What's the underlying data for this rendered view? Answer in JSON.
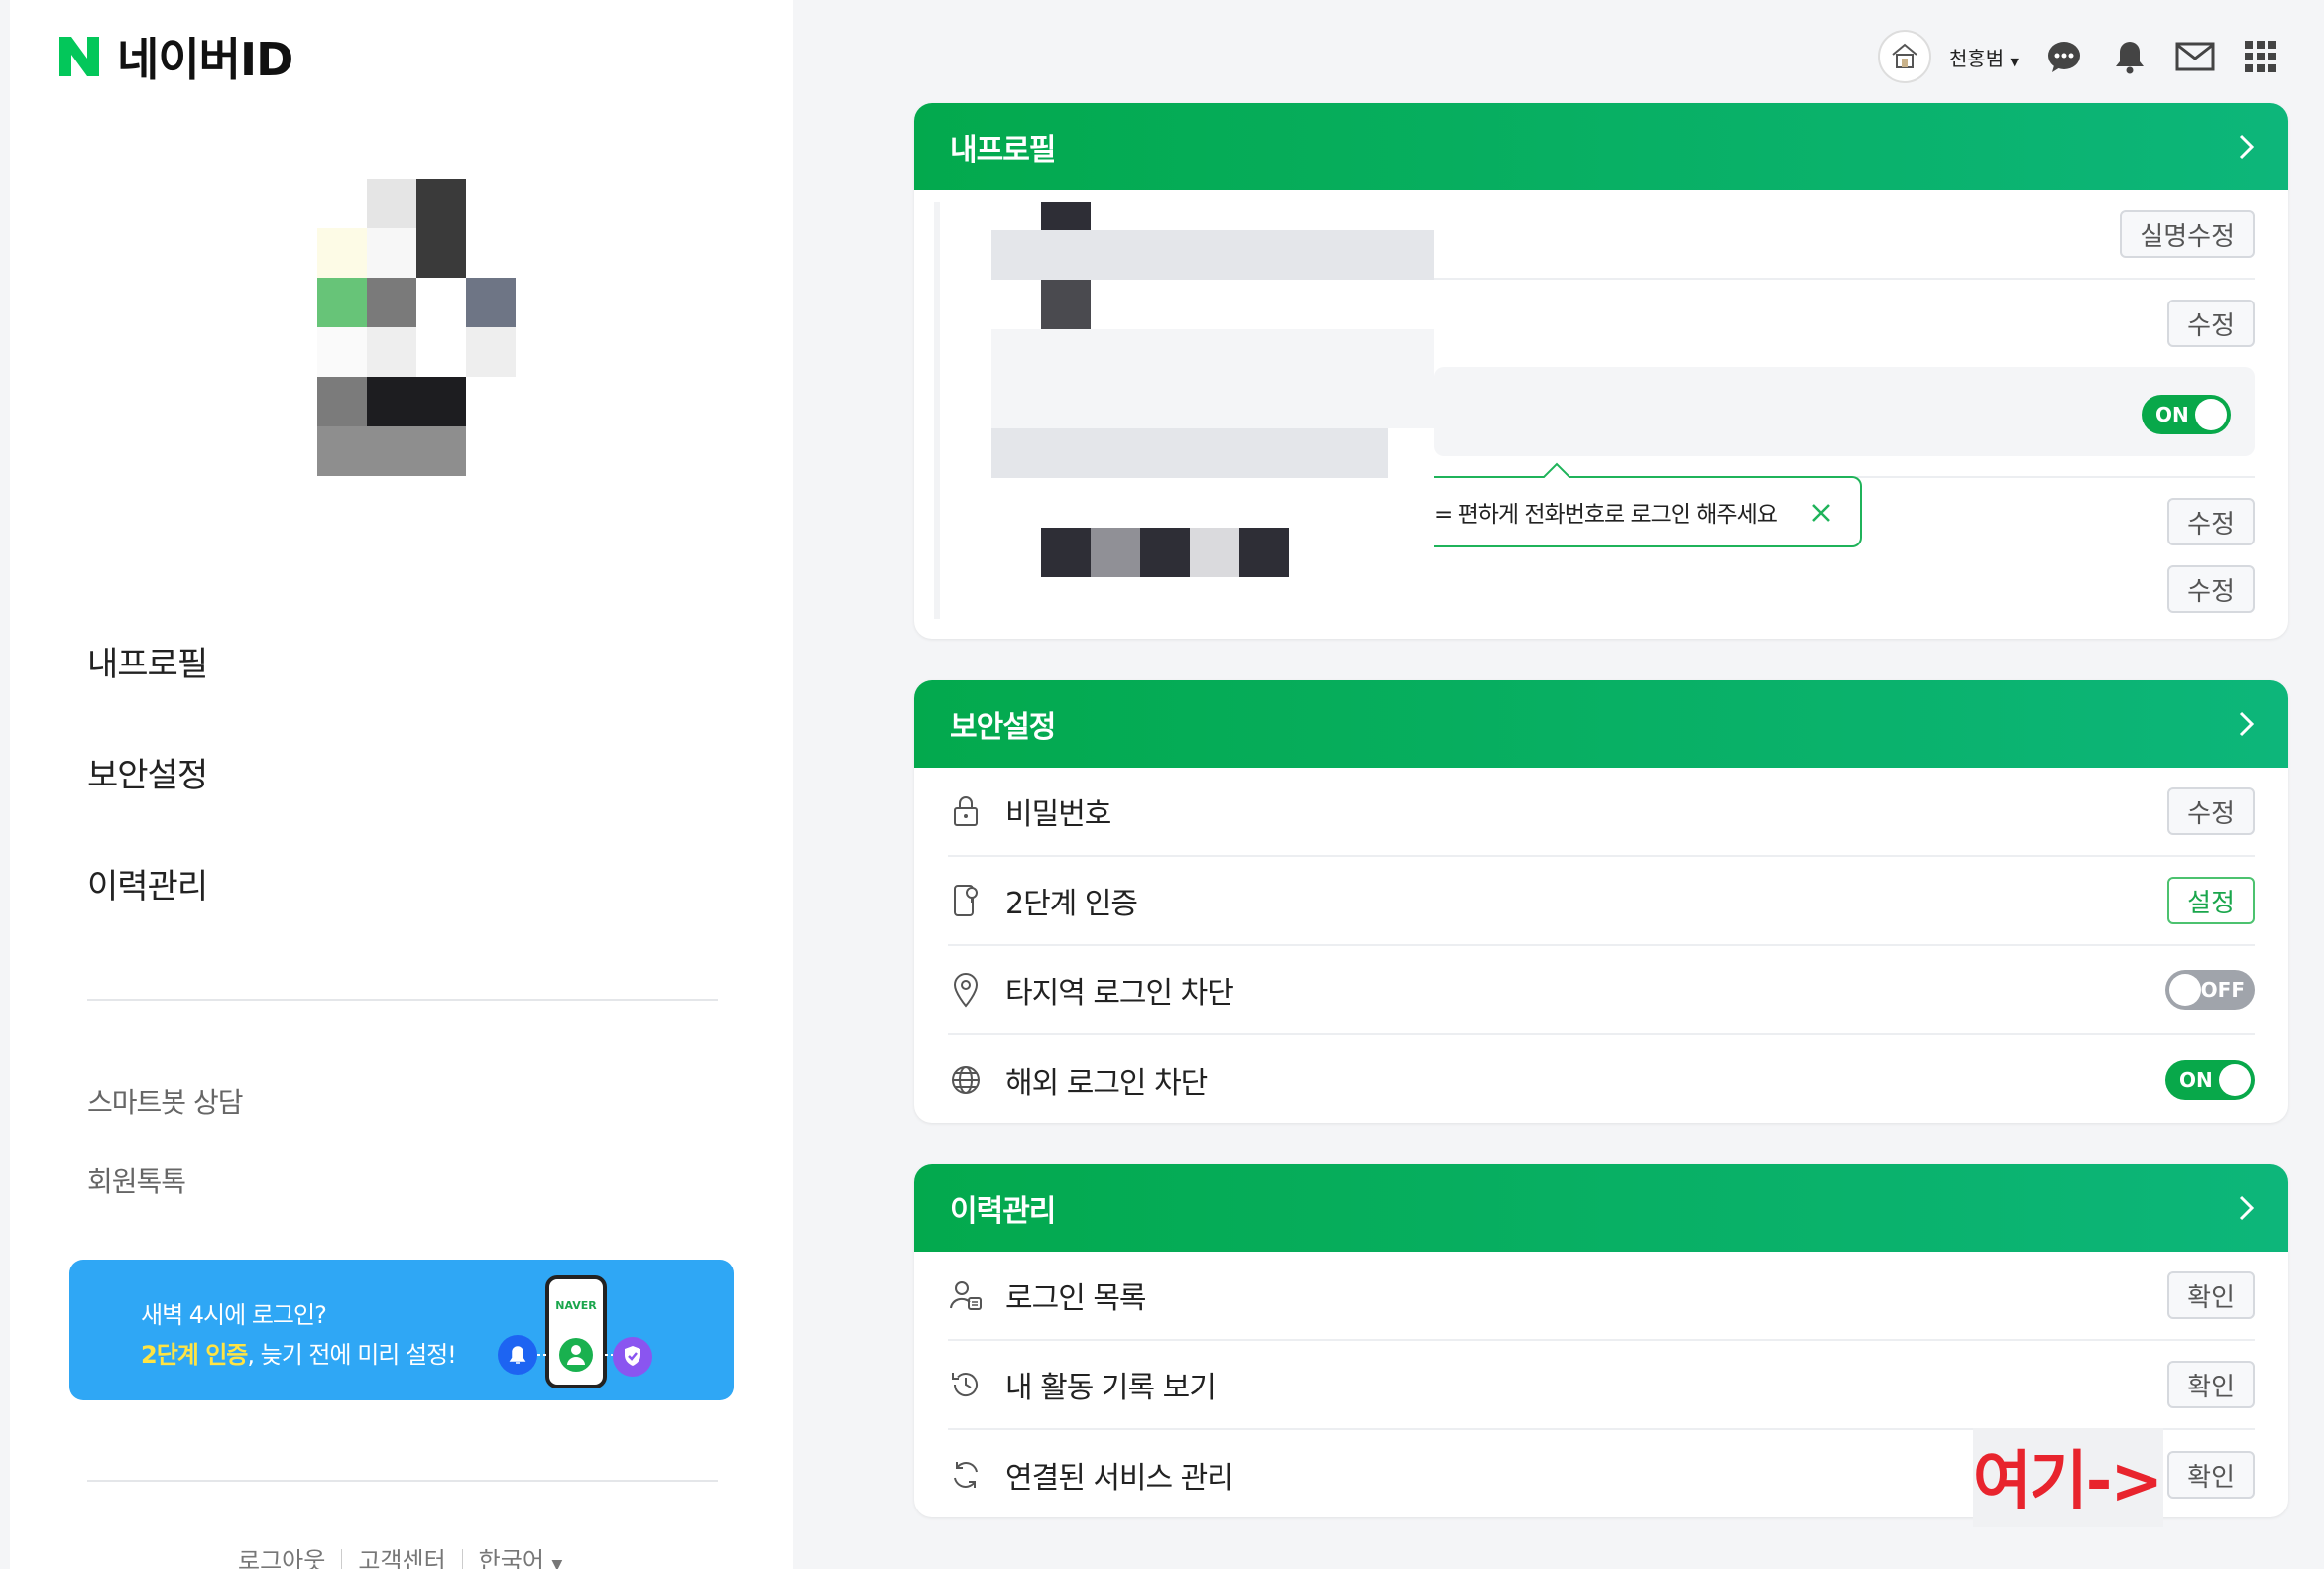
{
  "brand": {
    "logo_letter": "N",
    "title": "네이버ID",
    "accent": "#03c75a"
  },
  "left_nav": {
    "items": [
      "내프로필",
      "보안설정",
      "이력관리"
    ],
    "sub_links": [
      "스마트봇 상담",
      "회원톡톡"
    ]
  },
  "banner": {
    "line1": "새벽 4시에 로그인?",
    "highlight": "2단계 인증",
    "line2_rest": ", 늦기 전에 미리 설정!",
    "badge": "NAVER"
  },
  "footer": {
    "logout": "로그아웃",
    "help": "고객센터",
    "language": "한국어"
  },
  "header": {
    "user_name": "천홍범",
    "icons": [
      "talk-icon",
      "bell-icon",
      "mail-icon",
      "apps-grid-icon"
    ]
  },
  "profile_card": {
    "title": "내프로필",
    "buttons": [
      "실명수정",
      "수정",
      "수정",
      "수정"
    ],
    "toggle_label": "ON",
    "tooltip": "= 편하게 전화번호로 로그인 해주세요"
  },
  "security_card": {
    "title": "보안설정",
    "rows": [
      {
        "label": "비밀번호",
        "icon": "lock-icon",
        "action": "수정"
      },
      {
        "label": "2단계 인증",
        "icon": "phone-key-icon",
        "action": "설정"
      },
      {
        "label": "타지역 로그인 차단",
        "icon": "location-pin-icon",
        "toggle": "OFF"
      },
      {
        "label": "해외 로그인 차단",
        "icon": "globe-icon",
        "toggle": "ON"
      }
    ]
  },
  "history_card": {
    "title": "이력관리",
    "rows": [
      {
        "label": "로그인 목록",
        "icon": "user-list-icon",
        "action": "확인"
      },
      {
        "label": "내 활동 기록 보기",
        "icon": "history-clock-icon",
        "action": "확인"
      },
      {
        "label": "연결된 서비스 관리",
        "icon": "refresh-icon",
        "action": "확인"
      }
    ]
  },
  "annotation": {
    "text": "여기->",
    "color": "#e8242d"
  }
}
